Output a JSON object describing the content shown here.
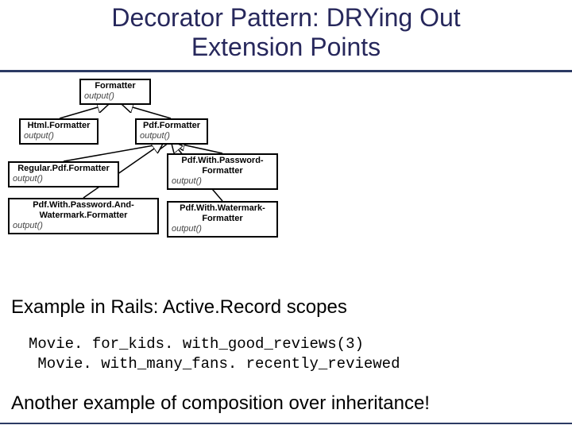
{
  "title_line1": "Decorator Pattern: DRYing Out",
  "title_line2": "Extension Points",
  "uml": {
    "formatter": {
      "name": "Formatter",
      "op": "output()"
    },
    "html": {
      "name": "Html.Formatter",
      "op": "output()"
    },
    "pdf": {
      "name": "Pdf.Formatter",
      "op": "output()"
    },
    "regular": {
      "name": "Regular.Pdf.Formatter",
      "op": "output()"
    },
    "password": {
      "name": "Pdf.With.Password-\nFormatter",
      "op": "output()"
    },
    "passwordwm": {
      "name": "Pdf.With.Password.And-\nWatermark.Formatter",
      "op": "output()"
    },
    "watermark": {
      "name": "Pdf.With.Watermark-\nFormatter",
      "op": "output()"
    }
  },
  "example_label": "Example in Rails: Active.Record scopes",
  "code": {
    "line1": "Movie. for_kids. with_good_reviews(3)",
    "line2": " Movie. with_many_fans. recently_reviewed"
  },
  "closing": "Another example of composition over inheritance!"
}
